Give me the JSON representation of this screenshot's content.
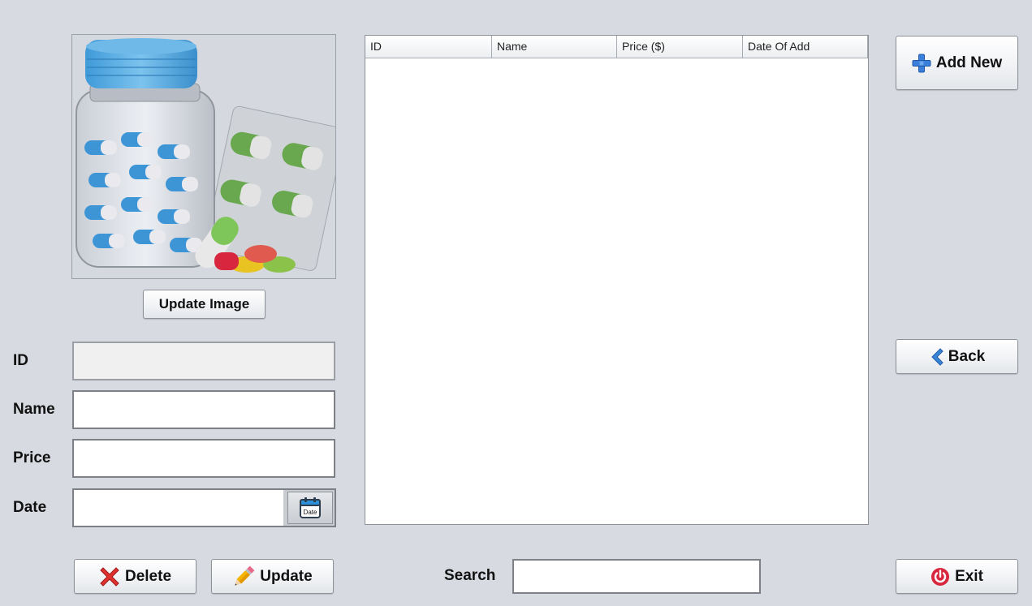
{
  "image_panel": {
    "icon": "medicine-jar-and-pills-image"
  },
  "buttons": {
    "update_image": "Update Image",
    "add_new": "Add New",
    "back": "Back",
    "exit": "Exit",
    "delete": "Delete",
    "update": "Update"
  },
  "form": {
    "id_label": "ID",
    "name_label": "Name",
    "price_label": "Price",
    "date_label": "Date",
    "id_value": "",
    "name_value": "",
    "price_value": "",
    "date_value": "",
    "date_button_text": "Date"
  },
  "table": {
    "columns": [
      "ID",
      "Name",
      "Price ($)",
      "Date Of Add"
    ],
    "rows": []
  },
  "search": {
    "label": "Search",
    "value": ""
  },
  "icons": {
    "add": "plus-icon",
    "back": "chevron-left-icon",
    "exit": "power-icon",
    "delete": "x-icon",
    "update": "pencil-icon",
    "date": "calendar-icon"
  },
  "colors": {
    "background": "#d7dae1",
    "add_icon": "#3a7fd9",
    "back_icon": "#3a86d6",
    "exit_icon": "#d7263d",
    "delete_icon": "#d7263d"
  }
}
